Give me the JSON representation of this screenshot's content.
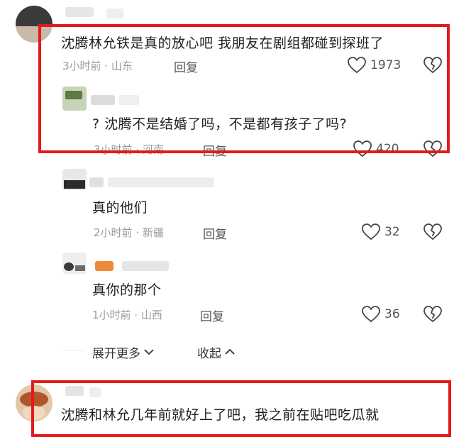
{
  "comments": [
    {
      "text": "沈腾林允铁是真的放心吧 我朋友在剧组都碰到探班了",
      "time_location": "3小时前 · 山东",
      "reply_label": "回复",
      "likes": "1973"
    },
    {
      "text": "? 沈腾不是结婚了吗，不是都有孩子了吗?",
      "time_location": "3小时前 · 河南",
      "reply_label": "回复",
      "likes": "420"
    },
    {
      "text": "真的他们",
      "time_location": "2小时前 · 新疆",
      "reply_label": "回复",
      "likes": "32"
    },
    {
      "text": "真你的那个",
      "time_location": "1小时前 · 山西",
      "reply_label": "回复",
      "likes": "36"
    }
  ],
  "thread_controls": {
    "expand_label": "展开更多",
    "collapse_label": "收起"
  },
  "bottom_comment": {
    "text": "沈腾和林允几年前就好上了吧，我之前在贴吧吃瓜就"
  },
  "colors": {
    "highlight_box": "#e41a1a",
    "meta_text": "#9a9a9a"
  }
}
